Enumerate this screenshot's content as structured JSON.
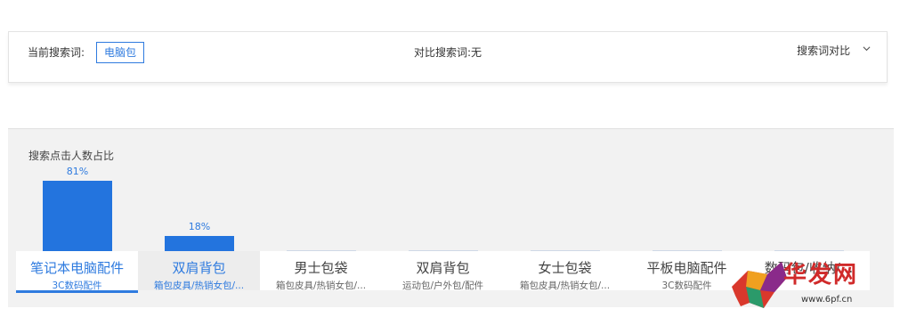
{
  "search": {
    "current_label": "当前搜索词:",
    "current_keyword": "电脑包",
    "compare_label": "对比搜索词:无",
    "compare_toggle": "搜索词对比"
  },
  "chart_data": {
    "type": "bar",
    "title": "搜索点击人数占比",
    "categories": [
      "笔记本电脑配件",
      "双肩背包",
      "男士包袋",
      "双肩背包",
      "女士包袋",
      "平板电脑配件",
      "数码包/收纳/..."
    ],
    "values": [
      81,
      18,
      0,
      0,
      0,
      0,
      0
    ],
    "data_labels": [
      "81%",
      "18%",
      "",
      "",
      "",
      "",
      ""
    ],
    "ylim": [
      0,
      100
    ],
    "color": "#2374de"
  },
  "tabs": [
    {
      "name": "笔记本电脑配件",
      "sub": "3C数码配件",
      "state": "active"
    },
    {
      "name": "双肩背包",
      "sub": "箱包皮具/热销女包/...",
      "state": "hover"
    },
    {
      "name": "男士包袋",
      "sub": "箱包皮具/热销女包/...",
      "state": ""
    },
    {
      "name": "双肩背包",
      "sub": "运动包/户外包/配件",
      "state": ""
    },
    {
      "name": "女士包袋",
      "sub": "箱包皮具/热销女包/...",
      "state": ""
    },
    {
      "name": "平板电脑配件",
      "sub": "3C数码配件",
      "state": ""
    },
    {
      "name": "数码包/收纳/...",
      "sub": "",
      "state": ""
    }
  ],
  "watermark": {
    "text": "华发网",
    "url": "www.6pf.cn"
  },
  "colors": {
    "accent": "#2f7bdf",
    "bar": "#2374de",
    "panel_bg": "#f2f2f2"
  }
}
